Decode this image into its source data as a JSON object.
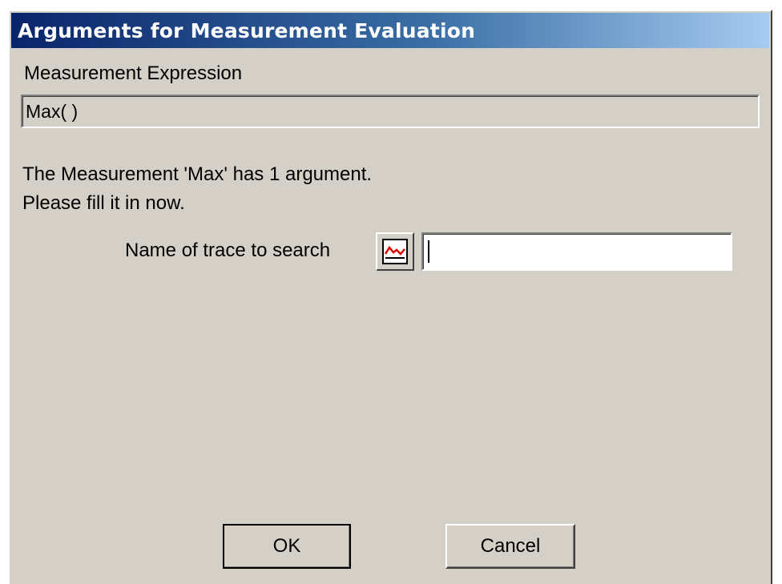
{
  "window": {
    "title": "Arguments for Measurement Evaluation"
  },
  "expression": {
    "label": "Measurement Expression",
    "value": "Max( )"
  },
  "info": {
    "line1": "The Measurement 'Max' has 1 argument.",
    "line2": "Please fill it in now."
  },
  "argument": {
    "label": "Name of trace to search",
    "value": "",
    "picker_icon": "trace-waveform-icon"
  },
  "buttons": {
    "ok": "OK",
    "cancel": "Cancel"
  },
  "colors": {
    "title_start": "#0a246a",
    "title_end": "#a6caf0",
    "face": "#d4d0c8",
    "trace_icon": "#e00000"
  }
}
